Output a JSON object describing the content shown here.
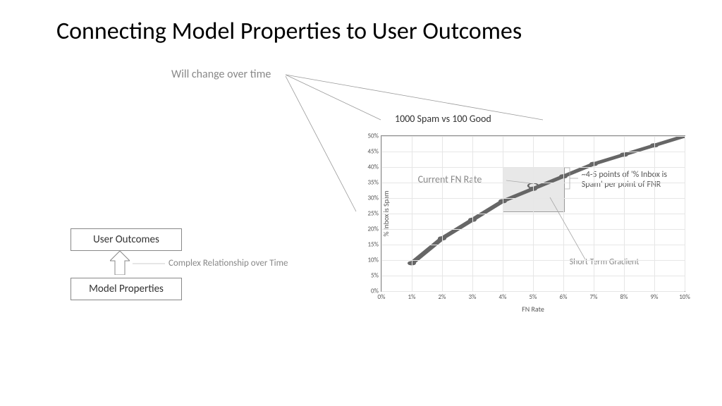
{
  "title": "Connecting Model Properties to User Outcomes",
  "subtitle": "Will change over time",
  "boxes": {
    "user_outcomes": "User Outcomes",
    "model_properties": "Model Properties"
  },
  "arrow_caption": "Complex Relationship over Time",
  "chart_data": {
    "type": "line",
    "title": "1000 Spam vs 100 Good",
    "xlabel": "FN Rate",
    "ylabel": "% Inbox is Spam",
    "xlim_pct": [
      0,
      10
    ],
    "ylim_pct": [
      0,
      50
    ],
    "xticks_pct": [
      0,
      1,
      2,
      3,
      4,
      5,
      6,
      7,
      8,
      9,
      10
    ],
    "yticks_pct": [
      0,
      5,
      10,
      15,
      20,
      25,
      30,
      35,
      40,
      45,
      50
    ],
    "x_pct": [
      1,
      2,
      3,
      4,
      5,
      6,
      7,
      8,
      9,
      10
    ],
    "y_pct": [
      9,
      17,
      23,
      29,
      33,
      37,
      41,
      44,
      47,
      50
    ],
    "annotations": {
      "current_fn_rate": "Current FN Rate",
      "gradient_note": "~4-5 points of '% Inbox is Spam' per point of FNR",
      "short_term": "Short Term Gradient"
    }
  }
}
